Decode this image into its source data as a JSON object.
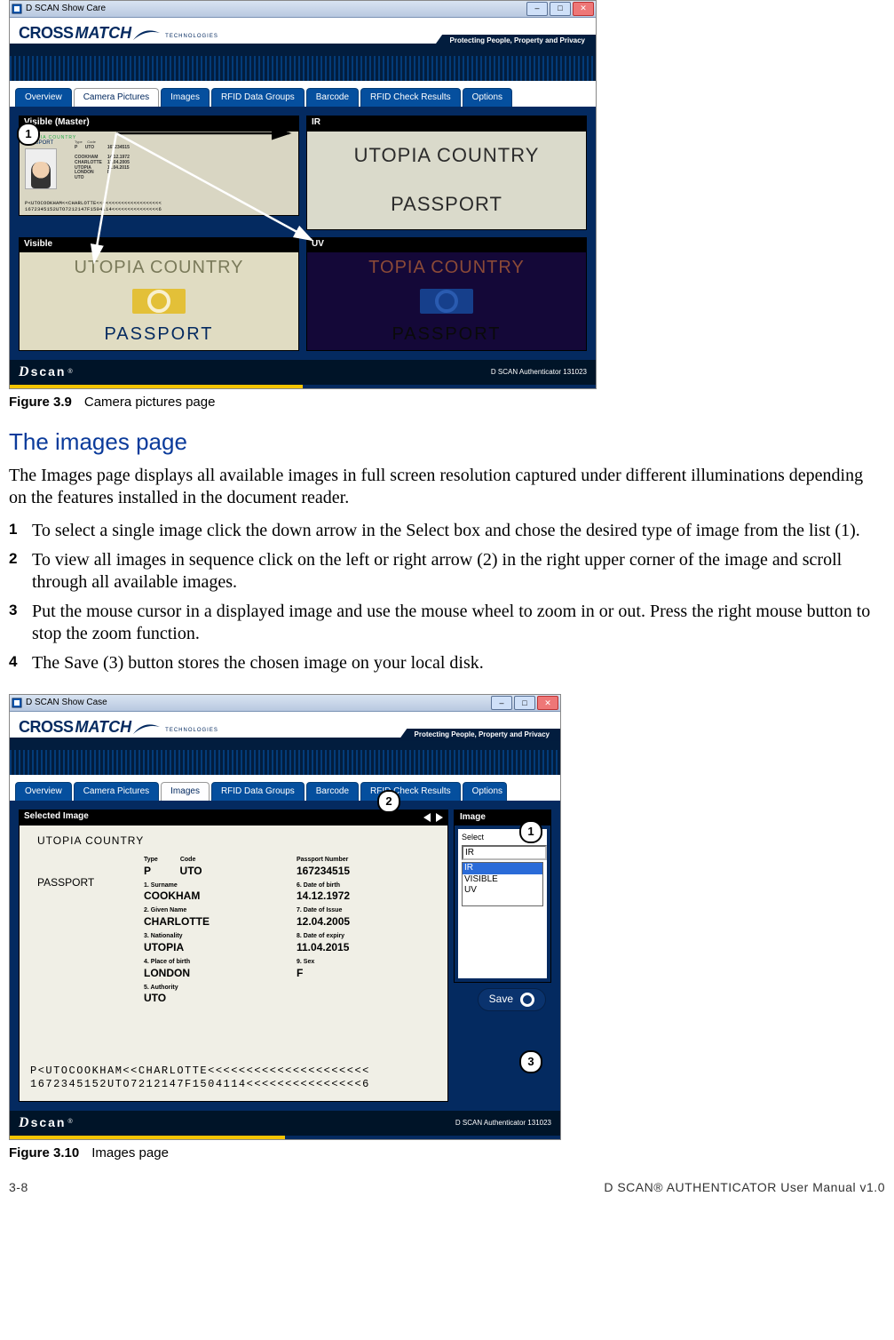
{
  "footer": {
    "page": "3-8",
    "manual": "D SCAN®  AUTHENTICATOR User Manual  v1.0"
  },
  "tagline": "Protecting People, Property and Privacy",
  "productFooter": "D SCAN Authenticator 131023",
  "common": {
    "windowTitle": "D SCAN Show Care",
    "windowTitle2": "D SCAN Show Case",
    "tabs": [
      "Overview",
      "Camera Pictures",
      "Images",
      "RFID Data Groups",
      "Barcode",
      "RFID Check Results",
      "Options"
    ]
  },
  "fig39": {
    "captionNum": "Figure 3.9",
    "captionText": "Camera pictures page",
    "activeTab": "Camera Pictures",
    "panels": {
      "tl": "Visible (Master)",
      "tr": "IR",
      "bl": "Visible",
      "br": "UV"
    },
    "ir": {
      "line1": "UTOPIA COUNTRY",
      "line2": "PASSPORT"
    },
    "vis": {
      "line1": "UTOPIA COUNTRY",
      "line2": "PASSPORT"
    },
    "uv": {
      "line1": "TOPIA COUNTRY",
      "line2": "PASSPORT"
    },
    "bio": {
      "country": "UTOPIA COUNTRY",
      "passport": "PASSPORT",
      "type": "P",
      "code": "UTO",
      "number": "167234515",
      "surname": "COOKHAM",
      "given": "CHARLOTTE",
      "nationality": "UTOPIA",
      "dob": "14.12.1972",
      "doi": "12.04.2005",
      "doe": "11.04.2015",
      "pob": "LONDON",
      "sex": "F",
      "authority": "UTO",
      "mrz1": "P<UTOCOOKHAM<<CHARLOTTE<<<<<<<<<<<<<<<<<<<<<",
      "mrz2": "1672345152UTO7212147F1504114<<<<<<<<<<<<<<<6"
    }
  },
  "section": {
    "heading": "The images page",
    "para": "The Images page displays all available images in full screen resolution captured under different illuminations depending on the features installed in the document reader.",
    "steps": [
      "To select a single image click the down arrow in the Select box and chose the desired type of image from the list (1).",
      "To view all images in sequence click on the left or right arrow (2) in the right upper corner of the image and scroll through all available images.",
      "Put the mouse cursor in a displayed image and use the mouse wheel to zoom in or out. Press the right mouse button to stop the zoom function.",
      "The Save (3) button stores the chosen image on your local disk."
    ]
  },
  "fig310": {
    "captionNum": "Figure 3.10",
    "captionText": "Images page",
    "activeTab": "Images",
    "selectedHead": "Selected Image",
    "sideHead": "Image",
    "selectLabel": "Select",
    "selectValue": "IR",
    "selectOptions": [
      "IR",
      "VISIBLE",
      "UV"
    ],
    "saveLabel": "Save",
    "bio": {
      "country": "UTOPIA COUNTRY",
      "passport": "PASSPORT",
      "typeK": "Type",
      "type": "P",
      "codeK": "Code",
      "code": "UTO",
      "numK": "Passport Number",
      "number": "167234515",
      "surK": "1. Surname",
      "surname": "COOKHAM",
      "givK": "2. Given Name",
      "given": "CHARLOTTE",
      "natK": "3. Nationality",
      "nationality": "UTOPIA",
      "pobK": "4. Place of birth",
      "pob": "LONDON",
      "autK": "5. Authority",
      "authority": "UTO",
      "dobK": "6. Date of birth",
      "dob": "14.12.1972",
      "doiK": "7. Date of Issue",
      "doi": "12.04.2005",
      "doeK": "8. Date of expiry",
      "doe": "11.04.2015",
      "sexK": "9. Sex",
      "sex": "F",
      "mrz1": "P<UTOCOOKHAM<<CHARLOTTE<<<<<<<<<<<<<<<<<<<<<",
      "mrz2": "1672345152UTO7212147F1504114<<<<<<<<<<<<<<<6"
    }
  }
}
